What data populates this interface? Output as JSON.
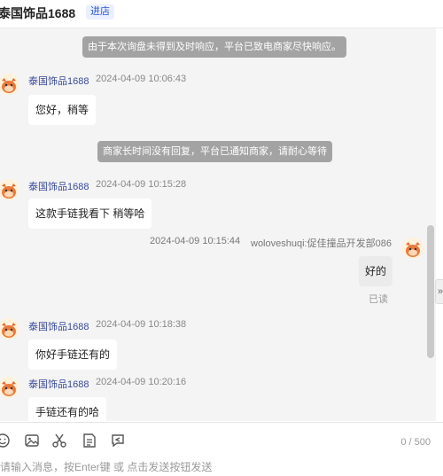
{
  "header": {
    "shop_name": "泰国饰品1688",
    "enter_label": "进店"
  },
  "system_notices": [
    "由于本次询盘未得到及时响应，平台已致电商家尽快响应。",
    "商家长时间没有回复，平台已通知商家，请耐心等待"
  ],
  "messages": [
    {
      "sender": "泰国饰品1688",
      "time": "2024-04-09 10:06:43",
      "text": "您好，稍等"
    },
    {
      "sender": "泰国饰品1688",
      "time": "2024-04-09 10:15:28",
      "text": "这款手链我看下 稍等哈"
    },
    {
      "sender": "woloveshuqi:促佳撞品开发部086",
      "time": "2024-04-09 10:15:44",
      "text": "好的",
      "status": "已读"
    },
    {
      "sender": "泰国饰品1688",
      "time": "2024-04-09 10:18:38",
      "text": "你好手链还有的"
    },
    {
      "sender": "泰国饰品1688",
      "time": "2024-04-09 10:20:16",
      "text": "手链还有的哈"
    }
  ],
  "toolbar": {
    "icons": [
      "emoji-icon",
      "image-icon",
      "scissors-icon",
      "order-icon",
      "quick-reply-icon"
    ],
    "counter": "0 / 500",
    "side_toggle": "»"
  },
  "input": {
    "placeholder": "请输入消息，按Enter键 或 点击发送按钮发送"
  }
}
